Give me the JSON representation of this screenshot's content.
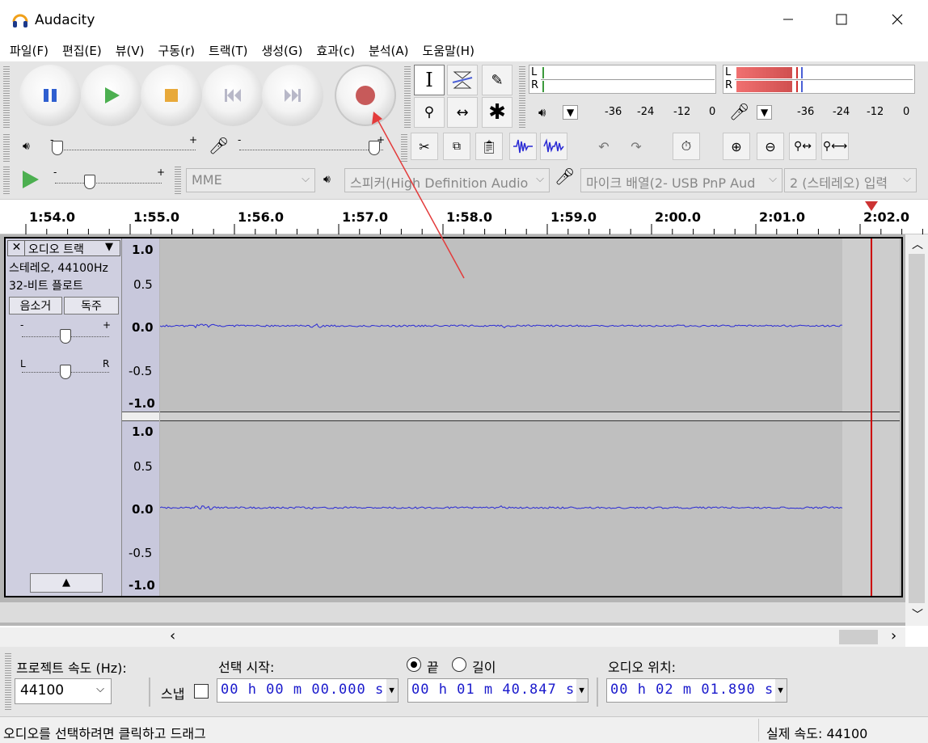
{
  "window": {
    "title": "Audacity",
    "minimize_glyph": "—",
    "maximize_glyph": "☐",
    "close_glyph": "✕"
  },
  "menu": [
    "파일(F)",
    "편집(E)",
    "뷰(V)",
    "구동(r)",
    "트랙(T)",
    "생성(G)",
    "효과(c)",
    "분석(A)",
    "도움말(H)"
  ],
  "meters": {
    "play_scale": [
      "-36",
      "-24",
      "-12",
      "0"
    ],
    "rec_scale": [
      "-36",
      "-24",
      "-12",
      "0"
    ],
    "left_label": "L",
    "right_label": "R",
    "rec_level_left": 0.32,
    "rec_level_right": 0.32
  },
  "device": {
    "host": "MME",
    "output": "스피커(High Definition Audio",
    "input": "마이크 배열(2- USB PnP Aud",
    "channels": "2 (스테레오) 입력"
  },
  "sliders": {
    "minus": "-",
    "plus": "+"
  },
  "timeline": [
    "1:54.0",
    "1:55.0",
    "1:56.0",
    "1:57.0",
    "1:58.0",
    "1:59.0",
    "2:00.0",
    "2:01.0",
    "2:02.0"
  ],
  "track": {
    "name": "오디오 트랙",
    "rate": "스테레오, 44100Hz",
    "format": "32-비트 플로트",
    "mute": "음소거",
    "solo": "독주",
    "pan_left": "L",
    "pan_right": "R",
    "collapse": "▲",
    "close": "✕",
    "menu_arrow": "▼"
  },
  "yscale": [
    "1.0",
    "0.5",
    "0.0",
    "-0.5",
    "-1.0"
  ],
  "selection_toolbar": {
    "project_rate_label": "프로젝트 속도 (Hz):",
    "project_rate": "44100",
    "snap_label": "스냅",
    "start_label": "선택 시작:",
    "end_label": "끝",
    "length_label": "길이",
    "start_value": "00 h 00 m 00.000 s",
    "end_value": "00 h 01 m 40.847 s",
    "position_label": "오디오 위치:",
    "position_value": "00 h 02 m 01.890 s"
  },
  "status": {
    "hint": "오디오를 선택하려면 클릭하고 드래그",
    "rate": "실제 속도: 44100"
  },
  "colors": {
    "record": "#c75a5a",
    "play": "#4caf50",
    "pause": "#2f5fd0",
    "stop": "#e8a93a",
    "waveform": "#2b2bd4",
    "playhead": "#cc0000",
    "arrow": "#e33b3b"
  }
}
